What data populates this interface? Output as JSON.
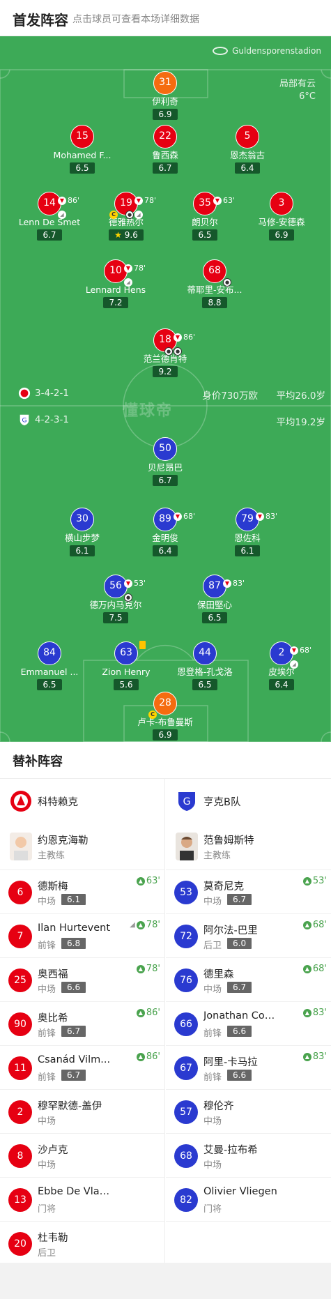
{
  "header": {
    "title": "首发阵容",
    "subtitle": "点击球员可查看本场详细数据"
  },
  "venue": {
    "name": "Guldensporenstadion",
    "weather": "局部有云",
    "temp": "6°C"
  },
  "home": {
    "formation": "3-4-2-1",
    "value": "身价730万欧",
    "avg_age": "平均26.0岁",
    "color": "#e60012",
    "players": [
      {
        "no": "31",
        "name": "伊利奇",
        "rating": "6.9",
        "kit": "o"
      },
      {
        "no": "15",
        "name": "Mohamed F...",
        "rating": "6.5",
        "kit": "r"
      },
      {
        "no": "22",
        "name": "鲁西森",
        "rating": "6.7",
        "kit": "r"
      },
      {
        "no": "5",
        "name": "恩杰翁古",
        "rating": "6.4",
        "kit": "r"
      },
      {
        "no": "14",
        "name": "Lenn De Smet",
        "rating": "6.7",
        "kit": "r",
        "sub": "86'"
      },
      {
        "no": "19",
        "name": "德雅热尔",
        "rating": "9.6",
        "kit": "r",
        "sub": "78'",
        "captain": true,
        "star": true
      },
      {
        "no": "35",
        "name": "朗贝尔",
        "rating": "6.5",
        "kit": "r",
        "sub": "63'"
      },
      {
        "no": "3",
        "name": "马修-安德森",
        "rating": "6.9",
        "kit": "r"
      },
      {
        "no": "10",
        "name": "Lennard Hens",
        "rating": "7.2",
        "kit": "r",
        "sub": "78'"
      },
      {
        "no": "68",
        "name": "蒂耶里-安布...",
        "rating": "8.8",
        "kit": "r"
      },
      {
        "no": "18",
        "name": "范兰德肖特",
        "rating": "9.2",
        "kit": "r",
        "sub": "86'"
      }
    ]
  },
  "away": {
    "formation": "4-2-3-1",
    "avg_age": "平均19.2岁",
    "color": "#2a3ad0",
    "players": [
      {
        "no": "50",
        "name": "贝尼昂巴",
        "rating": "6.7",
        "kit": "b"
      },
      {
        "no": "30",
        "name": "横山步梦",
        "rating": "6.1",
        "kit": "b"
      },
      {
        "no": "89",
        "name": "金明俊",
        "rating": "6.4",
        "kit": "b",
        "sub": "68'"
      },
      {
        "no": "79",
        "name": "恩佐科",
        "rating": "6.1",
        "kit": "b",
        "sub": "83'"
      },
      {
        "no": "56",
        "name": "德万内马克尔",
        "rating": "7.5",
        "kit": "b",
        "sub": "53'"
      },
      {
        "no": "87",
        "name": "保田堅心",
        "rating": "6.5",
        "kit": "b",
        "sub": "83'"
      },
      {
        "no": "84",
        "name": "Emmanuel ...",
        "rating": "6.5",
        "kit": "b"
      },
      {
        "no": "63",
        "name": "Zion Henry",
        "rating": "5.6",
        "kit": "b"
      },
      {
        "no": "44",
        "name": "恩登格-孔戈洛",
        "rating": "6.5",
        "kit": "b"
      },
      {
        "no": "2",
        "name": "皮埃尔",
        "rating": "6.4",
        "kit": "b",
        "sub": "68'"
      },
      {
        "no": "28",
        "name": "卢卡-布鲁曼斯",
        "rating": "6.9",
        "kit": "o",
        "captain": true
      }
    ]
  },
  "subs": {
    "title": "替补阵容",
    "home": {
      "team": "科特赖克",
      "coach": {
        "name": "约恩克海勒",
        "role": "主教练"
      },
      "list": [
        {
          "no": "6",
          "name": "德斯梅",
          "pos": "中场",
          "rating": "6.1",
          "time": "63'"
        },
        {
          "no": "7",
          "name": "Ilan Hurtevent",
          "pos": "前锋",
          "rating": "6.8",
          "time": "78'"
        },
        {
          "no": "25",
          "name": "奥西福",
          "pos": "中场",
          "rating": "6.6",
          "time": "78'"
        },
        {
          "no": "90",
          "name": "奥比希",
          "pos": "前锋",
          "rating": "6.7",
          "time": "86'"
        },
        {
          "no": "11",
          "name": "Csanád Vilm...",
          "pos": "前锋",
          "rating": "6.7",
          "time": "86'"
        },
        {
          "no": "2",
          "name": "穆罕默德-盖伊",
          "pos": "中场"
        },
        {
          "no": "8",
          "name": "沙卢克",
          "pos": "中场"
        },
        {
          "no": "13",
          "name": "Ebbe De Vlae...",
          "pos": "门将"
        },
        {
          "no": "20",
          "name": "杜韦勒",
          "pos": "后卫"
        }
      ]
    },
    "away": {
      "team": "亨克B队",
      "coach": {
        "name": "范鲁姆斯特",
        "role": "主教练"
      },
      "list": [
        {
          "no": "53",
          "name": "莫奇尼克",
          "pos": "中场",
          "rating": "6.7",
          "time": "53'"
        },
        {
          "no": "72",
          "name": "阿尔法-巴里",
          "pos": "后卫",
          "rating": "6.0",
          "time": "68'"
        },
        {
          "no": "76",
          "name": "德里森",
          "pos": "中场",
          "rating": "6.7",
          "time": "68'"
        },
        {
          "no": "66",
          "name": "Jonathan Coe...",
          "pos": "前锋",
          "rating": "6.6",
          "time": "83'"
        },
        {
          "no": "67",
          "name": "阿里-卡马拉",
          "pos": "前锋",
          "rating": "6.6",
          "time": "83'"
        },
        {
          "no": "57",
          "name": "穆伦齐",
          "pos": "中场"
        },
        {
          "no": "68",
          "name": "艾曼-拉布希",
          "pos": "中场"
        },
        {
          "no": "82",
          "name": "Olivier Vliegen",
          "pos": "门将"
        }
      ]
    }
  },
  "watermark": "懂球帝"
}
